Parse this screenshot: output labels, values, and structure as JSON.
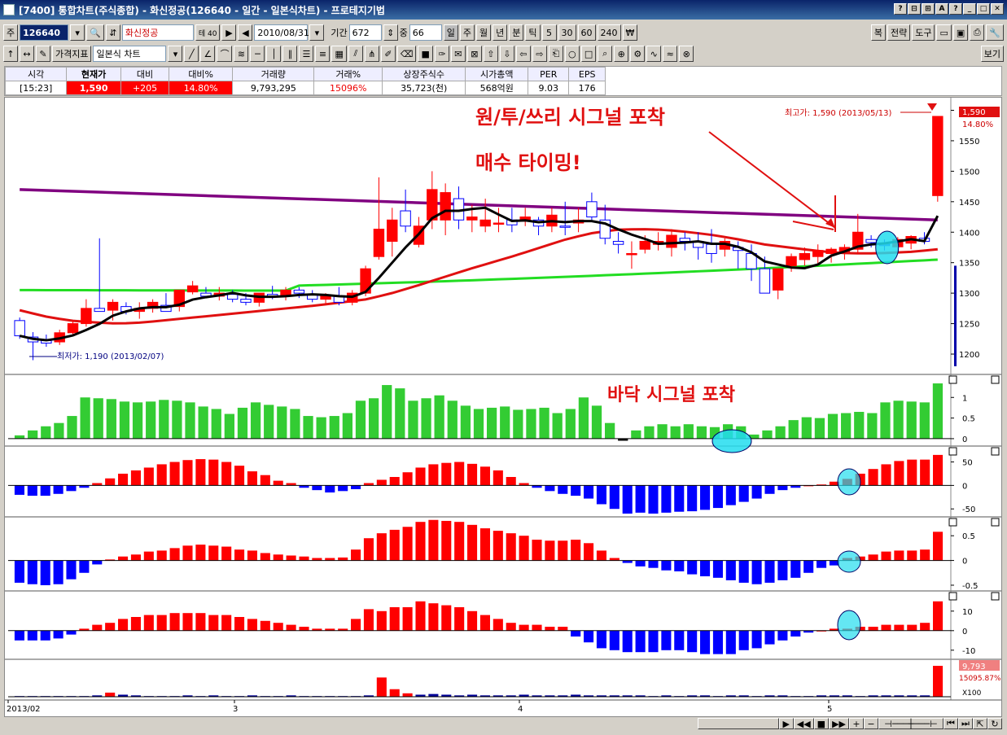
{
  "window": {
    "title": "[7400] 통합차트(주식종합) - 화신정공(126640 - 일간 - 일본식차트) - 프로테지기법",
    "controls": [
      "?",
      "⊟",
      "⊞",
      "A",
      "?",
      "_",
      "□",
      "✕"
    ]
  },
  "toolbar1": {
    "type_label": "주",
    "code": "126640",
    "name": "화신정공",
    "badge": "테 40",
    "date": "2010/08/31",
    "period_label": "기간",
    "period_value": "672",
    "mid_label": "중",
    "mid_value": "66",
    "intervals": [
      "일",
      "주",
      "월",
      "년",
      "분",
      "틱",
      "5",
      "30",
      "60",
      "240",
      "₩"
    ],
    "right_buttons": [
      "복",
      "전략",
      "도구"
    ]
  },
  "toolbar2": {
    "indicator_label": "가격지표",
    "chart_type": "일본식 차트",
    "right_button": "보기"
  },
  "info": {
    "headers": [
      "시각",
      "현재가",
      "대비",
      "대비%",
      "거래량",
      "거래%",
      "상장주식수",
      "시가총액",
      "PER",
      "EPS"
    ],
    "values": [
      "[15:23]",
      "1,590",
      "+205",
      "14.80%",
      "9,793,295",
      "15096%",
      "35,723(천)",
      "568억원",
      "9.03",
      "176"
    ]
  },
  "annotations": {
    "signal": "원/투/쓰리 시그널 포착",
    "buy": "매수 타이밍!",
    "bottom": "바닥 시그널 포착",
    "high": "최고가: 1,590 (2013/05/13)",
    "low": "최저가: 1,190 (2013/02/07)",
    "price_tag": "1,590",
    "pct_tag": "14.80%",
    "vol_tag": "9,793",
    "volpct_tag": "15095.87%",
    "x100": "X100"
  },
  "colors": {
    "up": "#ff0000",
    "down": "#0000ff",
    "ma_purple": "#800080",
    "ma_red": "#e01010",
    "ma_green": "#22dd22",
    "ma_black": "#000000",
    "osc_green": "#33cc33",
    "highlight": "#22ddee"
  },
  "chart_data": [
    {
      "type": "candlestick",
      "x_ticks": [
        "2013/02",
        "3",
        "4",
        "5"
      ],
      "y_ticks": [
        1200,
        1250,
        1300,
        1350,
        1400,
        1450,
        1500,
        1550,
        1600
      ],
      "ylim": [
        1180,
        1610
      ],
      "ohlc": [
        [
          1255,
          1260,
          1225,
          1230
        ],
        [
          1228,
          1236,
          1190,
          1220
        ],
        [
          1222,
          1232,
          1212,
          1218
        ],
        [
          1220,
          1240,
          1215,
          1235
        ],
        [
          1235,
          1255,
          1230,
          1250
        ],
        [
          1250,
          1290,
          1245,
          1275
        ],
        [
          1275,
          1390,
          1270,
          1270
        ],
        [
          1272,
          1290,
          1255,
          1285
        ],
        [
          1278,
          1285,
          1265,
          1270
        ],
        [
          1270,
          1285,
          1258,
          1275
        ],
        [
          1275,
          1290,
          1268,
          1285
        ],
        [
          1280,
          1300,
          1275,
          1270
        ],
        [
          1278,
          1305,
          1270,
          1305
        ],
        [
          1302,
          1320,
          1298,
          1312
        ],
        [
          1300,
          1310,
          1292,
          1295
        ],
        [
          1295,
          1310,
          1288,
          1300
        ],
        [
          1298,
          1305,
          1285,
          1290
        ],
        [
          1290,
          1300,
          1280,
          1285
        ],
        [
          1285,
          1300,
          1278,
          1300
        ],
        [
          1298,
          1312,
          1290,
          1295
        ],
        [
          1295,
          1310,
          1288,
          1305
        ],
        [
          1305,
          1310,
          1292,
          1300
        ],
        [
          1298,
          1305,
          1285,
          1290
        ],
        [
          1290,
          1300,
          1282,
          1295
        ],
        [
          1295,
          1310,
          1280,
          1285
        ],
        [
          1285,
          1305,
          1280,
          1300
        ],
        [
          1300,
          1345,
          1295,
          1340
        ],
        [
          1360,
          1490,
          1355,
          1405
        ],
        [
          1385,
          1440,
          1360,
          1420
        ],
        [
          1435,
          1470,
          1400,
          1410
        ],
        [
          1380,
          1425,
          1375,
          1410
        ],
        [
          1420,
          1500,
          1405,
          1470
        ],
        [
          1420,
          1480,
          1395,
          1465
        ],
        [
          1455,
          1475,
          1405,
          1420
        ],
        [
          1420,
          1445,
          1400,
          1425
        ],
        [
          1410,
          1455,
          1400,
          1420
        ],
        [
          1415,
          1440,
          1400,
          1415
        ],
        [
          1420,
          1440,
          1400,
          1412
        ],
        [
          1418,
          1440,
          1410,
          1425
        ],
        [
          1420,
          1425,
          1395,
          1410
        ],
        [
          1410,
          1440,
          1400,
          1428
        ],
        [
          1410,
          1450,
          1395,
          1408
        ],
        [
          1415,
          1440,
          1400,
          1420
        ],
        [
          1450,
          1465,
          1420,
          1425
        ],
        [
          1420,
          1445,
          1380,
          1390
        ],
        [
          1385,
          1400,
          1365,
          1380
        ],
        [
          1365,
          1385,
          1340,
          1365
        ],
        [
          1372,
          1395,
          1365,
          1385
        ],
        [
          1380,
          1400,
          1370,
          1385
        ],
        [
          1375,
          1405,
          1360,
          1395
        ],
        [
          1390,
          1400,
          1370,
          1385
        ],
        [
          1385,
          1400,
          1355,
          1375
        ],
        [
          1380,
          1405,
          1350,
          1365
        ],
        [
          1372,
          1390,
          1360,
          1385
        ],
        [
          1375,
          1385,
          1340,
          1370
        ],
        [
          1365,
          1380,
          1320,
          1340
        ],
        [
          1340,
          1360,
          1300,
          1300
        ],
        [
          1305,
          1340,
          1290,
          1340
        ],
        [
          1345,
          1365,
          1335,
          1360
        ],
        [
          1355,
          1375,
          1345,
          1365
        ],
        [
          1360,
          1380,
          1345,
          1370
        ],
        [
          1365,
          1375,
          1350,
          1372
        ],
        [
          1368,
          1380,
          1355,
          1375
        ],
        [
          1372,
          1430,
          1365,
          1400
        ],
        [
          1388,
          1395,
          1375,
          1383
        ],
        [
          1380,
          1388,
          1370,
          1378
        ],
        [
          1376,
          1392,
          1368,
          1388
        ],
        [
          1382,
          1395,
          1372,
          1393
        ],
        [
          1390,
          1400,
          1380,
          1385
        ],
        [
          1460,
          1590,
          1450,
          1590
        ]
      ],
      "ma_purple": [
        1470,
        1420
      ],
      "ma_green": [
        1305,
        1355
      ],
      "ma_red": [
        1272,
        1262,
        1255,
        1252,
        1250,
        1252,
        1256,
        1260,
        1264,
        1268,
        1272,
        1276,
        1280,
        1285,
        1290,
        1300,
        1312,
        1325,
        1338,
        1350,
        1362,
        1375,
        1388,
        1398,
        1404,
        1405,
        1404,
        1400,
        1395,
        1388,
        1380,
        1375,
        1370,
        1366,
        1365,
        1366,
        1368,
        1372
      ]
    },
    {
      "type": "bar",
      "name": "osc1",
      "ylim": [
        -0.1,
        1.4
      ],
      "y_ticks": [
        0,
        0.5,
        1
      ],
      "values": [
        0.08,
        0.2,
        0.3,
        0.38,
        0.55,
        1.0,
        0.98,
        0.96,
        0.9,
        0.88,
        0.9,
        0.94,
        0.92,
        0.88,
        0.78,
        0.72,
        0.6,
        0.75,
        0.88,
        0.82,
        0.78,
        0.72,
        0.55,
        0.52,
        0.55,
        0.62,
        0.92,
        0.98,
        1.3,
        1.22,
        0.92,
        0.98,
        1.05,
        0.92,
        0.8,
        0.72,
        0.75,
        0.78,
        0.7,
        0.72,
        0.75,
        0.62,
        0.72,
        1.0,
        0.8,
        0.38,
        -0.05,
        0.2,
        0.3,
        0.35,
        0.3,
        0.35,
        0.3,
        0.28,
        0.35,
        0.3,
        0.1,
        0.2,
        0.3,
        0.45,
        0.52,
        0.5,
        0.6,
        0.62,
        0.65,
        0.62,
        0.88,
        0.92,
        0.9,
        0.88,
        1.34
      ]
    },
    {
      "type": "bar",
      "name": "osc2",
      "ylim": [
        -60,
        70
      ],
      "y_ticks": [
        -50,
        0,
        50
      ],
      "values": [
        -20,
        -22,
        -22,
        -18,
        -12,
        -5,
        5,
        15,
        25,
        32,
        38,
        45,
        50,
        54,
        56,
        55,
        50,
        42,
        30,
        22,
        10,
        5,
        -5,
        -10,
        -15,
        -12,
        -8,
        5,
        12,
        18,
        28,
        38,
        45,
        48,
        50,
        46,
        40,
        32,
        18,
        5,
        -5,
        -12,
        -18,
        -22,
        -28,
        -40,
        -50,
        -60,
        -58,
        -60,
        -58,
        -56,
        -55,
        -52,
        -48,
        -42,
        -35,
        -28,
        -18,
        -10,
        -5,
        0,
        2,
        8,
        14,
        25,
        35,
        45,
        52,
        55,
        55,
        65
      ]
    },
    {
      "type": "bar",
      "name": "osc3",
      "ylim": [
        -0.55,
        0.75
      ],
      "y_ticks": [
        -0.5,
        0,
        0.5
      ],
      "values": [
        -0.45,
        -0.48,
        -0.5,
        -0.48,
        -0.38,
        -0.25,
        -0.08,
        0.02,
        0.08,
        0.12,
        0.18,
        0.2,
        0.25,
        0.3,
        0.32,
        0.3,
        0.28,
        0.22,
        0.2,
        0.15,
        0.12,
        0.1,
        0.08,
        0.05,
        0.05,
        0.06,
        0.22,
        0.45,
        0.55,
        0.62,
        0.68,
        0.78,
        0.82,
        0.8,
        0.78,
        0.72,
        0.65,
        0.6,
        0.55,
        0.5,
        0.42,
        0.4,
        0.4,
        0.42,
        0.35,
        0.2,
        0.05,
        -0.05,
        -0.12,
        -0.15,
        -0.2,
        -0.22,
        -0.28,
        -0.32,
        -0.35,
        -0.4,
        -0.45,
        -0.48,
        -0.45,
        -0.4,
        -0.35,
        -0.25,
        -0.15,
        -0.1,
        0.05,
        0.08,
        0.12,
        0.18,
        0.2,
        0.2,
        0.22,
        0.58
      ]
    },
    {
      "type": "bar",
      "name": "osc4",
      "ylim": [
        -13,
        17
      ],
      "y_ticks": [
        -10,
        0,
        10
      ],
      "values": [
        -5,
        -5,
        -5,
        -4,
        -2,
        1,
        3,
        4,
        6,
        7,
        8,
        8,
        9,
        9,
        9,
        8,
        8,
        7,
        6,
        5,
        4,
        3,
        2,
        1,
        1,
        1,
        6,
        11,
        10,
        12,
        12,
        15,
        14,
        13,
        12,
        10,
        8,
        6,
        4,
        3,
        3,
        2,
        2,
        -3,
        -6,
        -9,
        -10,
        -11,
        -11,
        -11,
        -10,
        -10,
        -11,
        -12,
        -12,
        -12,
        -10,
        -9,
        -7,
        -5,
        -3,
        -1,
        0,
        1,
        1,
        2,
        2,
        3,
        3,
        3,
        4,
        15
      ]
    },
    {
      "type": "bar",
      "name": "volume",
      "ylim": [
        0,
        45
      ],
      "values": [
        1,
        1,
        1,
        1,
        1,
        1,
        2,
        6,
        3,
        2,
        1,
        1,
        1,
        2,
        1,
        2,
        1,
        1,
        2,
        1,
        1,
        2,
        1,
        1,
        1,
        1,
        1,
        2,
        28,
        11,
        5,
        3,
        4,
        3,
        2,
        3,
        2,
        2,
        2,
        3,
        2,
        2,
        2,
        3,
        2,
        2,
        2,
        2,
        2,
        1,
        2,
        1,
        2,
        2,
        1,
        2,
        2,
        1,
        2,
        2,
        1,
        1,
        2,
        2,
        2,
        1,
        2,
        2,
        2,
        2,
        2,
        45
      ]
    }
  ],
  "x100": "X100"
}
